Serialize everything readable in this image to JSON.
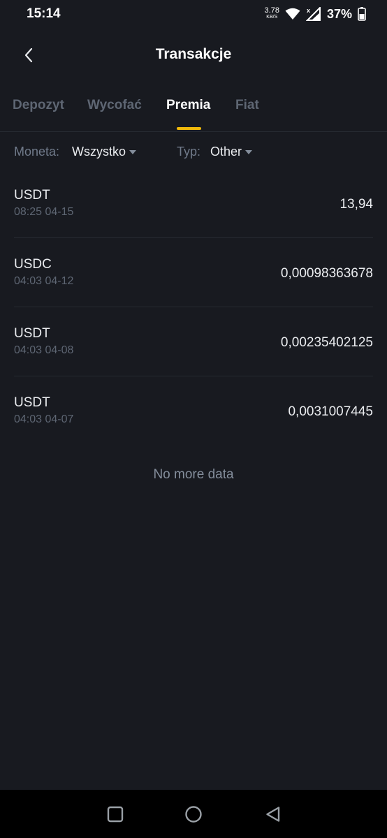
{
  "status_bar": {
    "time": "15:14",
    "net_speed_value": "3.78",
    "net_speed_unit": "KB/S",
    "battery_percent": "37%"
  },
  "header": {
    "title": "Transakcje"
  },
  "tabs": [
    {
      "label": "Depozyt",
      "active": false
    },
    {
      "label": "Wycofać",
      "active": false
    },
    {
      "label": "Premia",
      "active": true
    },
    {
      "label": "Fiat",
      "active": false
    }
  ],
  "filters": {
    "coin_label": "Moneta:",
    "coin_value": "Wszystko",
    "type_label": "Typ:",
    "type_value": "Other"
  },
  "transactions": [
    {
      "coin": "USDT",
      "time": "08:25 04-15",
      "amount": "13,94"
    },
    {
      "coin": "USDC",
      "time": "04:03 04-12",
      "amount": "0,00098363678"
    },
    {
      "coin": "USDT",
      "time": "04:03 04-08",
      "amount": "0,00235402125"
    },
    {
      "coin": "USDT",
      "time": "04:03 04-07",
      "amount": "0,0031007445"
    }
  ],
  "empty_message": "No more data",
  "colors": {
    "background": "#181A20",
    "accent": "#F0B90B",
    "text_primary": "#EAECEF",
    "text_secondary": "#707A8A"
  }
}
